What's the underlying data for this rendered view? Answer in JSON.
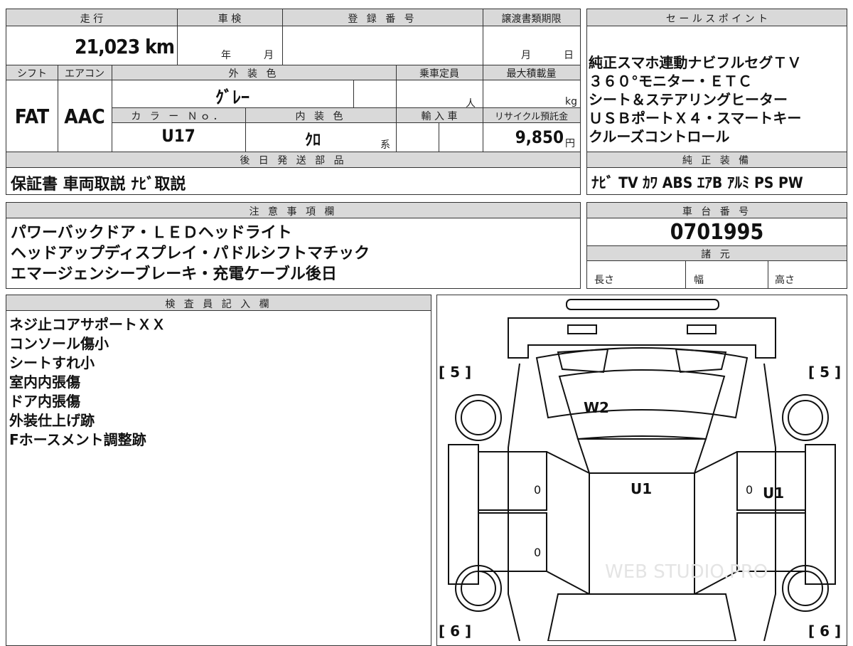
{
  "top": {
    "mileage_label": "走 行",
    "inspection_label": "車 検",
    "registration_label": "登 録 番 号",
    "deadline_label": "譲渡書類期限",
    "mileage_value": "21,023 km",
    "inspection_year": "年",
    "inspection_month": "月",
    "deadline_month": "月",
    "deadline_day": "日",
    "shift_label": "シフト",
    "ac_label": "エアコン",
    "exterior_label": "外 装 色",
    "capacity_label": "乗車定員",
    "load_label": "最大積載量",
    "shift_value": "FAT",
    "ac_value": "AAC",
    "exterior_value": "ｸﾞﾚｰ",
    "capacity_unit": "人",
    "load_unit": "kg",
    "color_no_label": "カ ラ ー Ｎｏ．",
    "interior_label": "内 装 色",
    "import_label": "輸 入 車",
    "recycle_label": "リサイクル預託金",
    "color_no_value": "U17",
    "interior_value": "ｸﾛ",
    "interior_suffix": "系",
    "recycle_value": "9,850",
    "recycle_unit": "円",
    "later_parts_label": "後 日 発 送 部 品",
    "later_parts_value": "保証書 車両取説 ﾅﾋﾞ取説"
  },
  "sales": {
    "label": "セ ー ル ス ポ イ ン ト",
    "lines": [
      "純正スマホ連動ナビフルセグＴＶ",
      "３６０°モニター・ＥＴＣ",
      "シート＆ステアリングヒーター",
      "ＵＳＢポートＸ４・スマートキー",
      "クルーズコントロール"
    ],
    "equipment_label": "純 正 装 備",
    "equipment_value": "ﾅﾋﾞ TV ｶﾜ ABS ｴｱB ｱﾙﾐ PS PW"
  },
  "notes": {
    "label": "注 意 事 項 欄",
    "lines": [
      "パワーバックドア・ＬＥＤヘッドライト",
      "ヘッドアップディスプレイ・パドルシフトマチック",
      "エマージェンシーブレーキ・充電ケーブル後日"
    ]
  },
  "chassis": {
    "label": "車 台 番 号",
    "value": "0701995",
    "spec_label": "諸 元",
    "length_label": "長さ",
    "width_label": "幅",
    "height_label": "高さ"
  },
  "inspector": {
    "label": "検 査 員 記 入 欄",
    "lines": [
      "ネジ止コアサポートＸＸ",
      "コンソール傷小",
      "シートすれ小",
      "室内内張傷",
      "ドア内張傷",
      "外装仕上げ跡",
      "Fホースメント調整跡"
    ]
  },
  "diagram": {
    "tire_front_left": "[ 5 ]",
    "tire_front_right": "[ 5 ]",
    "tire_rear_left": "[ 6 ]",
    "tire_rear_right": "[ 6 ]",
    "mark_windshield": "W2",
    "mark_roof": "U1",
    "mark_right_front_door": "U1",
    "door_zero_1": "0",
    "door_zero_2": "0",
    "door_zero_3": "0",
    "watermark": "WEB STUDIO.PRO"
  }
}
